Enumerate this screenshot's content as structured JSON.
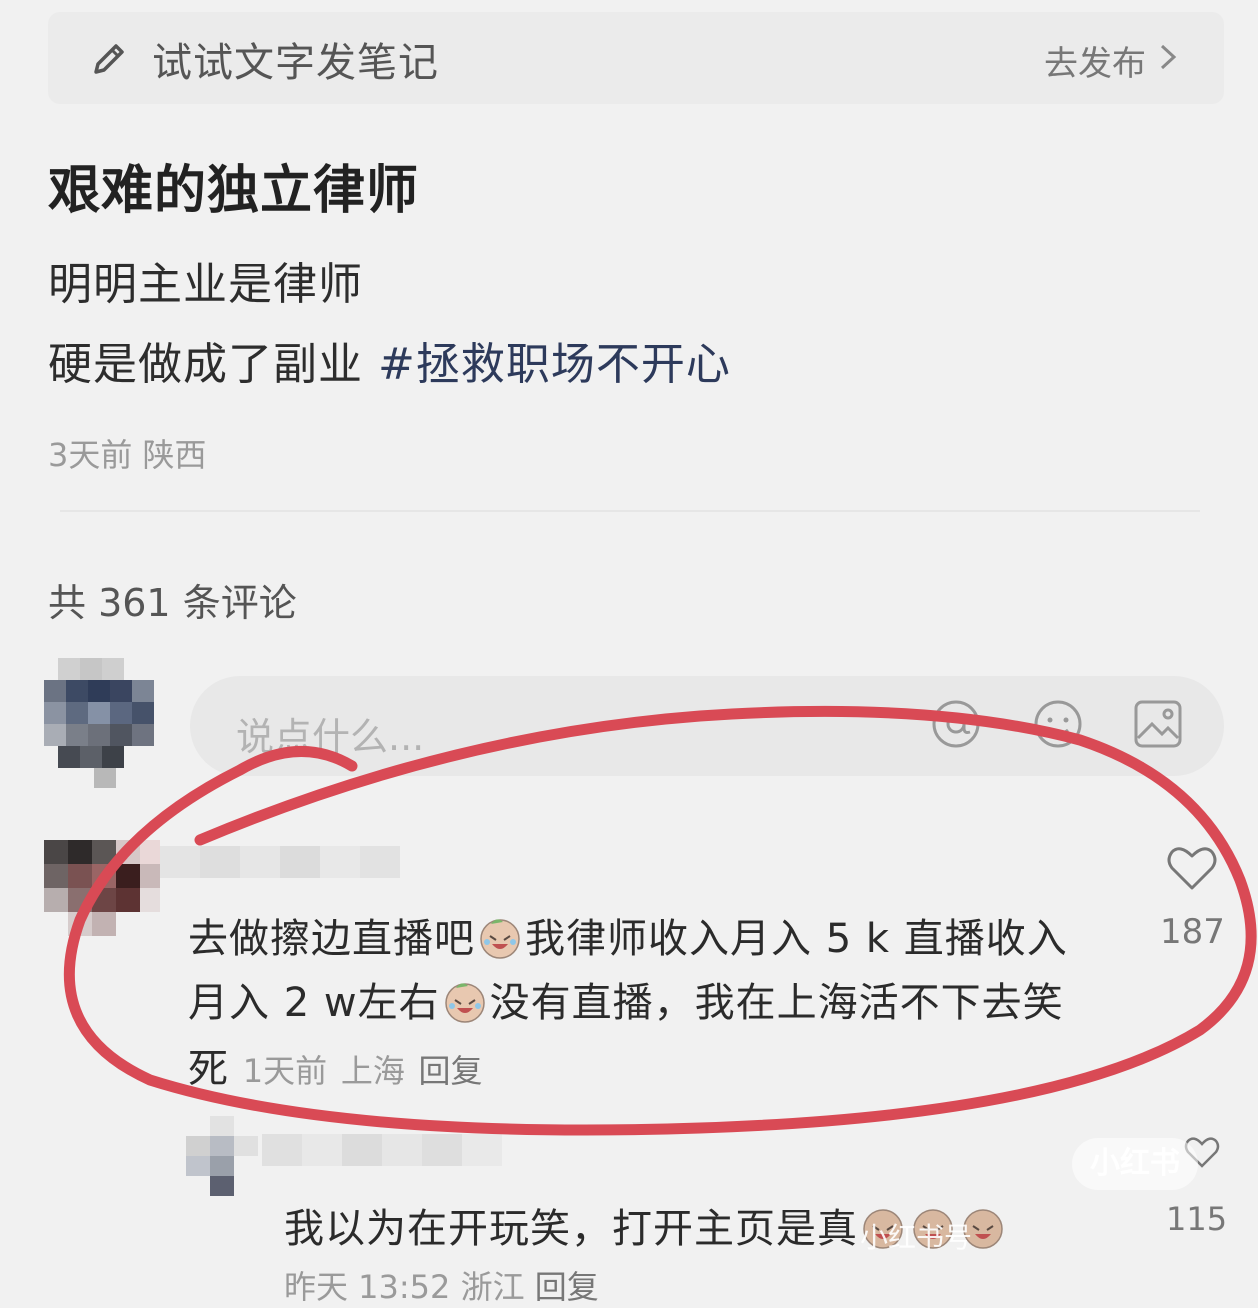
{
  "compose": {
    "placeholder": "试试文字发笔记",
    "publish_label": "去发布"
  },
  "post": {
    "title": "艰难的独立律师",
    "line1": "明明主业是律师",
    "line2_prefix": "硬是做成了副业 ",
    "hashtag": "#拯救职场不开心",
    "time": "3天前",
    "location": "陕西"
  },
  "comments_header": "共 361 条评论",
  "comment_input": {
    "placeholder": "说点什么..."
  },
  "comments": [
    {
      "text_part1": "去做擦边直播吧",
      "text_part2": "我律师收入月入 5 k 直播收入",
      "text_part3": "月入 2 w左右",
      "text_part4": "没有直播，我在上海活不下去笑",
      "text_part5": "死",
      "time": "1天前",
      "location": "上海",
      "reply_label": "回复",
      "likes": "187"
    },
    {
      "text": "我以为在开玩笑，打开主页是真",
      "time": "昨天 13:52",
      "location": "浙江",
      "reply_label": "回复",
      "likes": "115"
    }
  ],
  "watermark": "小红书",
  "watermark_id": "小红书号",
  "colors": {
    "annotation": "#d94a55",
    "hashtag": "#2d3a5b"
  },
  "icons": [
    "pencil-icon",
    "chevron-right-icon",
    "at-icon",
    "emoji-icon",
    "image-icon",
    "heart-icon",
    "laugh-cry-emoji"
  ]
}
